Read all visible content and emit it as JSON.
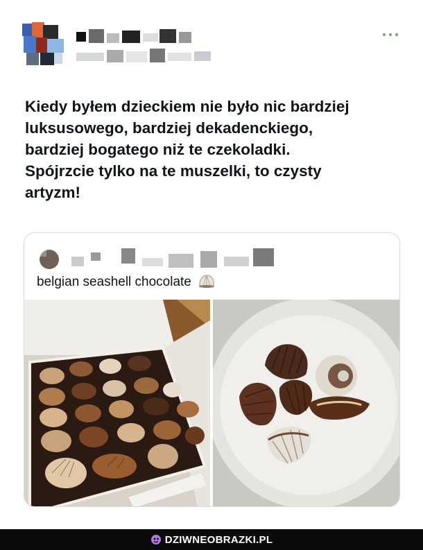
{
  "tweet": {
    "text_lines": [
      "Kiedy byłem dzieckiem nie było nic bardziej",
      "luksusowego, bardziej dekadenckiego,",
      "bardziej bogatego niż te czekoladki.",
      "Spójrzcie tylko na te muszelki, to czysty",
      "artyzm!"
    ],
    "icons": {
      "avatar": "blurred-avatar",
      "more": "more-options-icon"
    }
  },
  "quote": {
    "text": "belgian seashell chocolate",
    "emoji": "seashell-emoji",
    "images": [
      {
        "name": "chocolate-box-photo"
      },
      {
        "name": "chocolate-bowl-photo"
      }
    ]
  },
  "brand": {
    "label": "DZIWNEOBRAZKI.PL",
    "icon": "brand-logo-icon",
    "color": "#b07be0"
  },
  "colors": {
    "text": "#0f1419",
    "border": "#d7dbdf",
    "bar": "#0b0b0b"
  }
}
